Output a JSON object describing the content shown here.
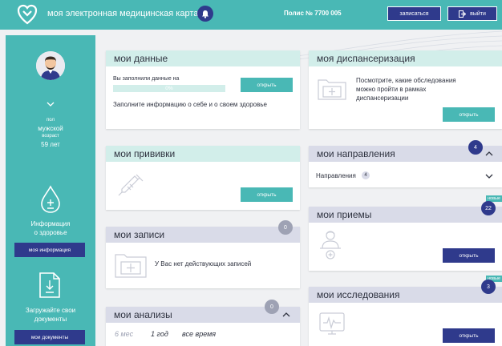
{
  "header": {
    "title": "моя электронная медицинская карта",
    "polis": "Полис № 7700 005",
    "signup_label": "записаться",
    "exit_label": "выйти"
  },
  "sidebar": {
    "sex_label": "пол",
    "sex_value": "мужской",
    "age_label": "возраст",
    "age_value": "59 лет",
    "health_info_line1": "Информация",
    "health_info_line2": "о здоровье",
    "my_info_button": "моя информация",
    "upload_line1": "Загружайте свои",
    "upload_line2": "документы",
    "my_docs_button": "мои документы"
  },
  "my_data": {
    "title": "мои данные",
    "filled_label": "Вы заполнили данные на",
    "progress_text": "0%",
    "progress_value": 0,
    "open_label": "открыть",
    "prompt": "Заполните информацию о себе и о своем здоровье"
  },
  "dispanser": {
    "title": "моя диспансеризация",
    "text_line1": "Посмотрите, какие обследования",
    "text_line2": "можно пройти в рамках",
    "text_line3": "диспансеризации",
    "open_label": "открыть"
  },
  "vaccines": {
    "title": "мои прививки",
    "open_label": "открыть"
  },
  "referrals": {
    "title": "мои направления",
    "badge": "4",
    "row_label": "Направления",
    "row_count": "4"
  },
  "appointments": {
    "title": "мои записи",
    "badge": "0",
    "empty_text": "У Вас нет действующих записей"
  },
  "visits": {
    "title": "мои приемы",
    "badge": "22",
    "new_tag": "новые",
    "open_label": "открыть"
  },
  "analyses": {
    "title": "мои анализы",
    "badge": "0",
    "periods": [
      "6 мес",
      "1 год",
      "все время"
    ]
  },
  "research": {
    "title": "мои исследования",
    "badge": "3",
    "new_tag": "новые",
    "open_label": "открыть"
  },
  "colors": {
    "teal": "#49b8b5",
    "navy": "#2f3a8c",
    "mint": "#d2eeea"
  }
}
